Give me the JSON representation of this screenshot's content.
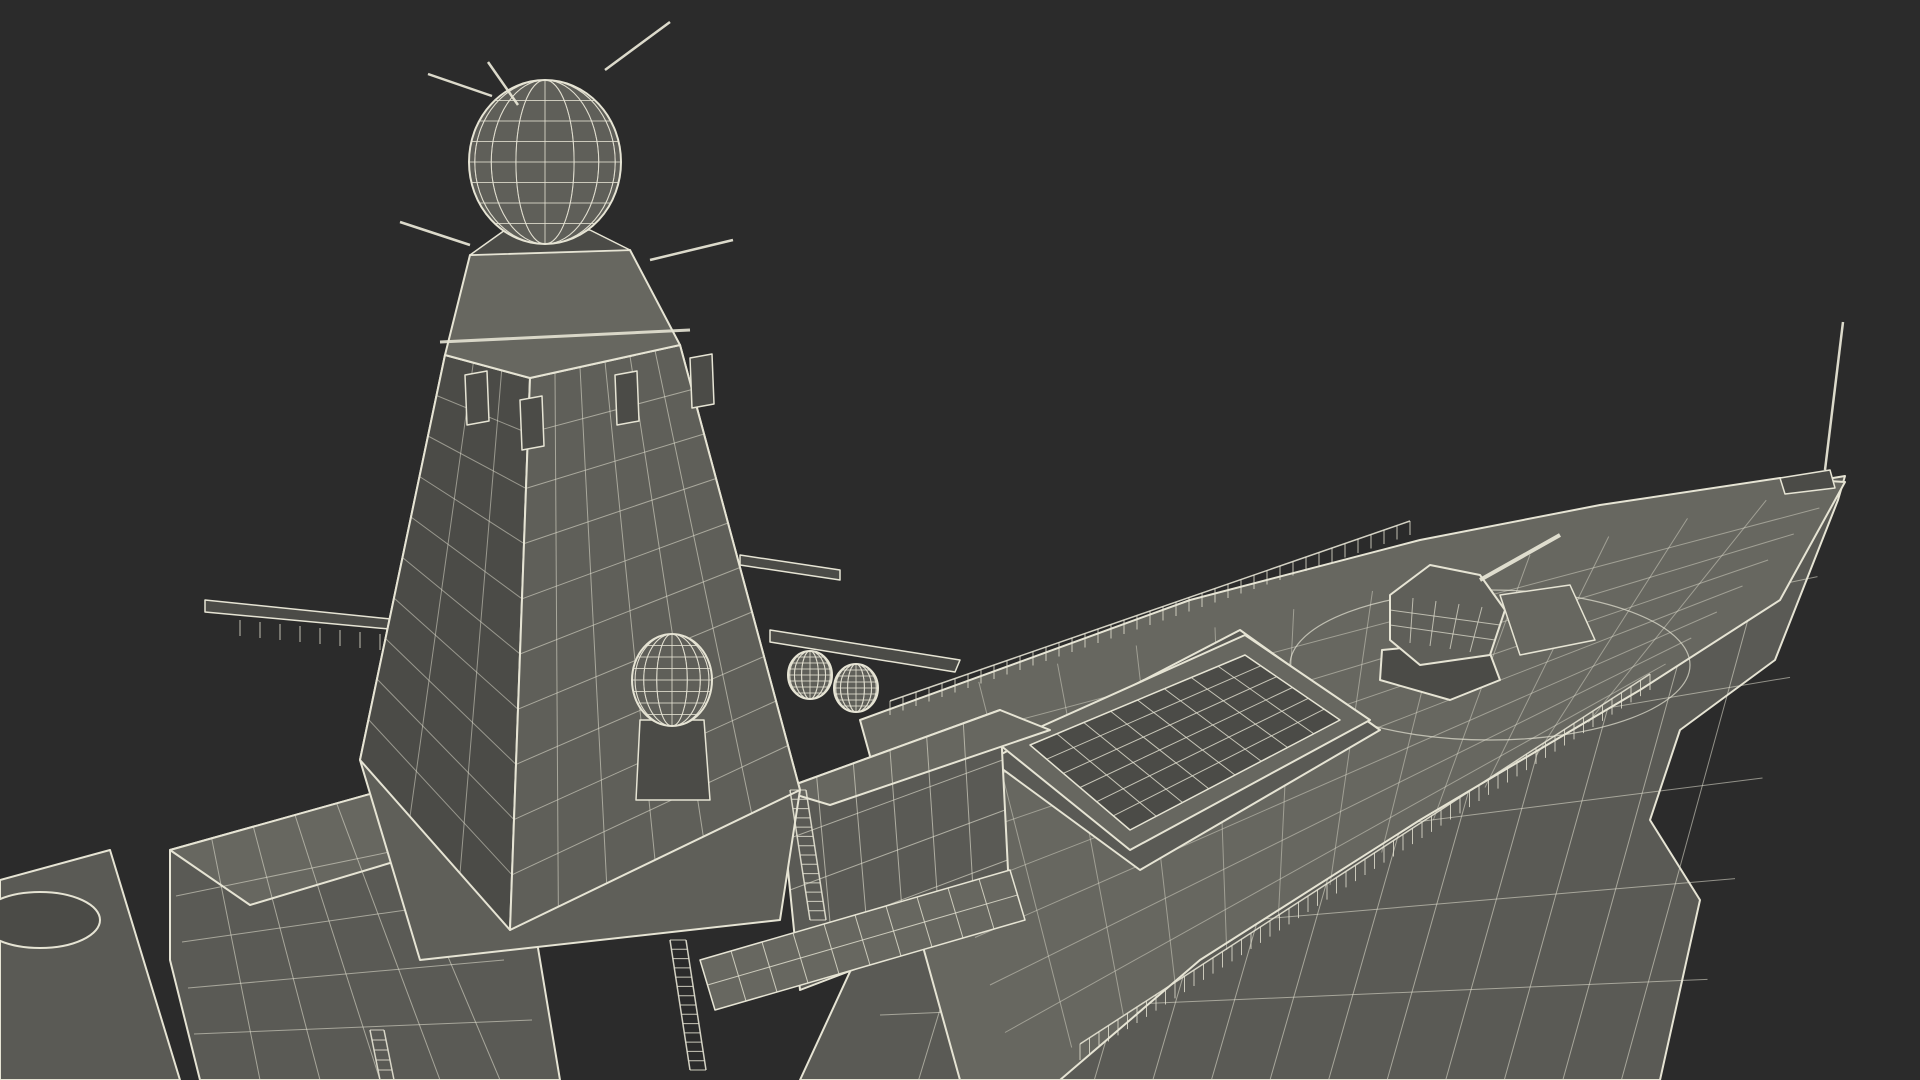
{
  "scene": {
    "subject": "warship-wireframe-render",
    "colors": {
      "background": "#2b2b2b",
      "hull_fill": "#5a5a55",
      "deck_fill": "#676760",
      "mast_fill": "#5f5f59",
      "shadow_fill": "#4b4b47",
      "wire": "#e6e4d4"
    }
  }
}
